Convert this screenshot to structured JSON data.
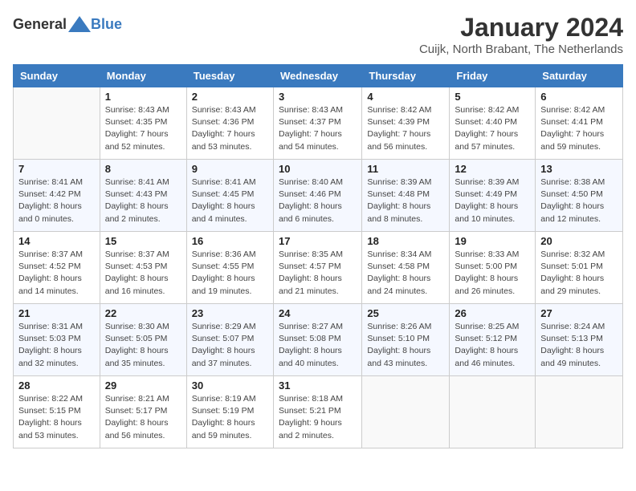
{
  "header": {
    "logo_general": "General",
    "logo_blue": "Blue",
    "month": "January 2024",
    "location": "Cuijk, North Brabant, The Netherlands"
  },
  "weekdays": [
    "Sunday",
    "Monday",
    "Tuesday",
    "Wednesday",
    "Thursday",
    "Friday",
    "Saturday"
  ],
  "weeks": [
    [
      {
        "day": "",
        "text": ""
      },
      {
        "day": "1",
        "text": "Sunrise: 8:43 AM\nSunset: 4:35 PM\nDaylight: 7 hours\nand 52 minutes."
      },
      {
        "day": "2",
        "text": "Sunrise: 8:43 AM\nSunset: 4:36 PM\nDaylight: 7 hours\nand 53 minutes."
      },
      {
        "day": "3",
        "text": "Sunrise: 8:43 AM\nSunset: 4:37 PM\nDaylight: 7 hours\nand 54 minutes."
      },
      {
        "day": "4",
        "text": "Sunrise: 8:42 AM\nSunset: 4:39 PM\nDaylight: 7 hours\nand 56 minutes."
      },
      {
        "day": "5",
        "text": "Sunrise: 8:42 AM\nSunset: 4:40 PM\nDaylight: 7 hours\nand 57 minutes."
      },
      {
        "day": "6",
        "text": "Sunrise: 8:42 AM\nSunset: 4:41 PM\nDaylight: 7 hours\nand 59 minutes."
      }
    ],
    [
      {
        "day": "7",
        "text": "Sunrise: 8:41 AM\nSunset: 4:42 PM\nDaylight: 8 hours\nand 0 minutes."
      },
      {
        "day": "8",
        "text": "Sunrise: 8:41 AM\nSunset: 4:43 PM\nDaylight: 8 hours\nand 2 minutes."
      },
      {
        "day": "9",
        "text": "Sunrise: 8:41 AM\nSunset: 4:45 PM\nDaylight: 8 hours\nand 4 minutes."
      },
      {
        "day": "10",
        "text": "Sunrise: 8:40 AM\nSunset: 4:46 PM\nDaylight: 8 hours\nand 6 minutes."
      },
      {
        "day": "11",
        "text": "Sunrise: 8:39 AM\nSunset: 4:48 PM\nDaylight: 8 hours\nand 8 minutes."
      },
      {
        "day": "12",
        "text": "Sunrise: 8:39 AM\nSunset: 4:49 PM\nDaylight: 8 hours\nand 10 minutes."
      },
      {
        "day": "13",
        "text": "Sunrise: 8:38 AM\nSunset: 4:50 PM\nDaylight: 8 hours\nand 12 minutes."
      }
    ],
    [
      {
        "day": "14",
        "text": "Sunrise: 8:37 AM\nSunset: 4:52 PM\nDaylight: 8 hours\nand 14 minutes."
      },
      {
        "day": "15",
        "text": "Sunrise: 8:37 AM\nSunset: 4:53 PM\nDaylight: 8 hours\nand 16 minutes."
      },
      {
        "day": "16",
        "text": "Sunrise: 8:36 AM\nSunset: 4:55 PM\nDaylight: 8 hours\nand 19 minutes."
      },
      {
        "day": "17",
        "text": "Sunrise: 8:35 AM\nSunset: 4:57 PM\nDaylight: 8 hours\nand 21 minutes."
      },
      {
        "day": "18",
        "text": "Sunrise: 8:34 AM\nSunset: 4:58 PM\nDaylight: 8 hours\nand 24 minutes."
      },
      {
        "day": "19",
        "text": "Sunrise: 8:33 AM\nSunset: 5:00 PM\nDaylight: 8 hours\nand 26 minutes."
      },
      {
        "day": "20",
        "text": "Sunrise: 8:32 AM\nSunset: 5:01 PM\nDaylight: 8 hours\nand 29 minutes."
      }
    ],
    [
      {
        "day": "21",
        "text": "Sunrise: 8:31 AM\nSunset: 5:03 PM\nDaylight: 8 hours\nand 32 minutes."
      },
      {
        "day": "22",
        "text": "Sunrise: 8:30 AM\nSunset: 5:05 PM\nDaylight: 8 hours\nand 35 minutes."
      },
      {
        "day": "23",
        "text": "Sunrise: 8:29 AM\nSunset: 5:07 PM\nDaylight: 8 hours\nand 37 minutes."
      },
      {
        "day": "24",
        "text": "Sunrise: 8:27 AM\nSunset: 5:08 PM\nDaylight: 8 hours\nand 40 minutes."
      },
      {
        "day": "25",
        "text": "Sunrise: 8:26 AM\nSunset: 5:10 PM\nDaylight: 8 hours\nand 43 minutes."
      },
      {
        "day": "26",
        "text": "Sunrise: 8:25 AM\nSunset: 5:12 PM\nDaylight: 8 hours\nand 46 minutes."
      },
      {
        "day": "27",
        "text": "Sunrise: 8:24 AM\nSunset: 5:13 PM\nDaylight: 8 hours\nand 49 minutes."
      }
    ],
    [
      {
        "day": "28",
        "text": "Sunrise: 8:22 AM\nSunset: 5:15 PM\nDaylight: 8 hours\nand 53 minutes."
      },
      {
        "day": "29",
        "text": "Sunrise: 8:21 AM\nSunset: 5:17 PM\nDaylight: 8 hours\nand 56 minutes."
      },
      {
        "day": "30",
        "text": "Sunrise: 8:19 AM\nSunset: 5:19 PM\nDaylight: 8 hours\nand 59 minutes."
      },
      {
        "day": "31",
        "text": "Sunrise: 8:18 AM\nSunset: 5:21 PM\nDaylight: 9 hours\nand 2 minutes."
      },
      {
        "day": "",
        "text": ""
      },
      {
        "day": "",
        "text": ""
      },
      {
        "day": "",
        "text": ""
      }
    ]
  ]
}
